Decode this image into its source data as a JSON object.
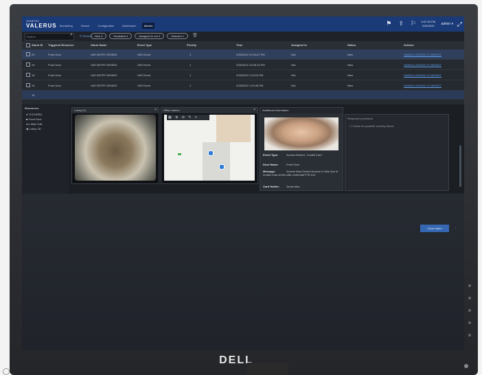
{
  "app": {
    "brand_small": "GENETEC",
    "brand_name": "VALERUS",
    "nav": [
      "Monitoring",
      "Search",
      "Configuration",
      "Dashboard",
      "Alarms"
    ],
    "active_nav": "Alarms",
    "clock_time": "5:57:30 PM",
    "clock_date": "2/25/2022",
    "user": "admin ▾"
  },
  "filter": {
    "search_placeholder": "Search",
    "refresh_label": "Refresh",
    "chips": [
      "New 4",
      "Escalated 4",
      "Assigned to me 0",
      "Selected 1"
    ]
  },
  "table": {
    "headers": [
      "Alarm ID",
      "Triggered Resource",
      "Alarm Name",
      "Event Type",
      "Priority",
      "Time",
      "Assigned to",
      "Status",
      "Actions"
    ],
    "rows": [
      {
        "id": "20",
        "resource": "Front Door",
        "name": "VAS ENTRY DENIED",
        "event": "VAS Event",
        "priority": "1",
        "time": "2/25/2022 12:54:47 PM",
        "assigned": "N/A",
        "status": "New",
        "action": "HANDLE ASSIGN TO MEEDIT"
      },
      {
        "id": "19",
        "resource": "Front Door",
        "name": "VAS ENTRY DENIED",
        "event": "VAS Event",
        "priority": "1",
        "time": "2/25/2022 12:56:13 PM",
        "assigned": "N/A",
        "status": "New",
        "action": "HANDLE ASSIGN TO MEEDIT"
      },
      {
        "id": "18",
        "resource": "Front Door",
        "name": "VAS ENTRY DENIED",
        "event": "VAS Event",
        "priority": "1",
        "time": "2/25/2022 1:03:22 PM",
        "assigned": "N/A",
        "status": "New",
        "action": "HANDLE ASSIGN TO MEEDIT"
      },
      {
        "id": "16",
        "resource": "Front Door",
        "name": "VAS ENTRY DENIED",
        "event": "VAS Event",
        "priority": "1",
        "time": "2/25/2022 1:03:45 PM",
        "assigned": "N/A",
        "status": "New",
        "action": "HANDLE ASSIGN TO MEEDIT"
      }
    ],
    "blank_row_id": "15"
  },
  "resources": {
    "title": "Resources",
    "items": [
      "● THCHDRA",
      "■ Front Door",
      "● ▸ Main Hall",
      "◉ Lobby 3D"
    ]
  },
  "camera": {
    "title": "Lobby (C)"
  },
  "map": {
    "title": "Office Interior"
  },
  "additional": {
    "title": "Additional information",
    "fields": [
      {
        "k": "Event Type:",
        "v": "Access Denied - Invalid Card"
      },
      {
        "k": "Door Name:",
        "v": "Front Door"
      },
      {
        "k": "Message:",
        "v": "Access Was Denied Access to Side due to Invalid Card at this with credential FTE-012"
      },
      {
        "k": "Card Holder:",
        "v": "Jonas Mao"
      }
    ]
  },
  "response": {
    "title": "Response procedure",
    "checkbox_label": "Check for possible security threat"
  },
  "close_button": "Close alarm",
  "monitor_logo": "DELL"
}
